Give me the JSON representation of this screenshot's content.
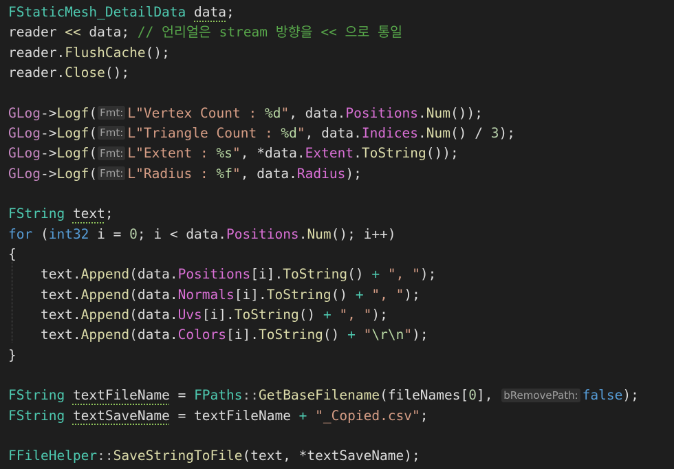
{
  "editor": {
    "lines": [
      [
        {
          "text": "FStaticMesh_DetailData",
          "type": "type"
        },
        {
          "text": " ",
          "type": "punc"
        },
        {
          "text": "data",
          "type": "var",
          "squiggle": true
        },
        {
          "text": ";",
          "type": "punc"
        }
      ],
      [
        {
          "text": "reader",
          "type": "var"
        },
        {
          "text": " ",
          "type": "punc"
        },
        {
          "text": "<<",
          "type": "func"
        },
        {
          "text": " data; ",
          "type": "var"
        },
        {
          "text": "// 언리얼은 stream 방향을 << 으로 통일",
          "type": "comment"
        }
      ],
      [
        {
          "text": "reader.",
          "type": "var"
        },
        {
          "text": "FlushCache",
          "type": "func"
        },
        {
          "text": "();",
          "type": "punc"
        }
      ],
      [
        {
          "text": "reader.",
          "type": "var"
        },
        {
          "text": "Close",
          "type": "func"
        },
        {
          "text": "();",
          "type": "punc"
        }
      ],
      [],
      [
        {
          "text": "GLog",
          "type": "macro"
        },
        {
          "text": "->",
          "type": "punc"
        },
        {
          "text": "Logf",
          "type": "func"
        },
        {
          "text": "(",
          "type": "punc"
        },
        {
          "text": "Fmt:",
          "type": "hint"
        },
        {
          "text": "L\"Vertex Count : ",
          "type": "str"
        },
        {
          "text": "%d",
          "type": "fmt"
        },
        {
          "text": "\"",
          "type": "str"
        },
        {
          "text": ", data.",
          "type": "var"
        },
        {
          "text": "Positions",
          "type": "field"
        },
        {
          "text": ".",
          "type": "punc"
        },
        {
          "text": "Num",
          "type": "func"
        },
        {
          "text": "());",
          "type": "punc"
        }
      ],
      [
        {
          "text": "GLog",
          "type": "macro"
        },
        {
          "text": "->",
          "type": "punc"
        },
        {
          "text": "Logf",
          "type": "func"
        },
        {
          "text": "(",
          "type": "punc"
        },
        {
          "text": "Fmt:",
          "type": "hint"
        },
        {
          "text": "L\"Triangle Count : ",
          "type": "str"
        },
        {
          "text": "%d",
          "type": "fmt"
        },
        {
          "text": "\"",
          "type": "str"
        },
        {
          "text": ", data.",
          "type": "var"
        },
        {
          "text": "Indices",
          "type": "field"
        },
        {
          "text": ".",
          "type": "punc"
        },
        {
          "text": "Num",
          "type": "func"
        },
        {
          "text": "() / ",
          "type": "punc"
        },
        {
          "text": "3",
          "type": "num"
        },
        {
          "text": ");",
          "type": "punc"
        }
      ],
      [
        {
          "text": "GLog",
          "type": "macro"
        },
        {
          "text": "->",
          "type": "punc"
        },
        {
          "text": "Logf",
          "type": "func"
        },
        {
          "text": "(",
          "type": "punc"
        },
        {
          "text": "Fmt:",
          "type": "hint"
        },
        {
          "text": "L\"Extent : ",
          "type": "str"
        },
        {
          "text": "%s",
          "type": "fmt"
        },
        {
          "text": "\"",
          "type": "str"
        },
        {
          "text": ", *data.",
          "type": "var"
        },
        {
          "text": "Extent",
          "type": "field"
        },
        {
          "text": ".",
          "type": "punc"
        },
        {
          "text": "ToString",
          "type": "func"
        },
        {
          "text": "());",
          "type": "punc"
        }
      ],
      [
        {
          "text": "GLog",
          "type": "macro"
        },
        {
          "text": "->",
          "type": "punc"
        },
        {
          "text": "Logf",
          "type": "func"
        },
        {
          "text": "(",
          "type": "punc"
        },
        {
          "text": "Fmt:",
          "type": "hint"
        },
        {
          "text": "L\"Radius : ",
          "type": "str"
        },
        {
          "text": "%f",
          "type": "fmt"
        },
        {
          "text": "\"",
          "type": "str"
        },
        {
          "text": ", data.",
          "type": "var"
        },
        {
          "text": "Radius",
          "type": "field"
        },
        {
          "text": ");",
          "type": "punc"
        }
      ],
      [],
      [
        {
          "text": "FString",
          "type": "type"
        },
        {
          "text": " ",
          "type": "punc"
        },
        {
          "text": "text",
          "type": "var",
          "squiggle": true
        },
        {
          "text": ";",
          "type": "punc"
        }
      ],
      [
        {
          "text": "for",
          "type": "kw"
        },
        {
          "text": " (",
          "type": "punc"
        },
        {
          "text": "int32",
          "type": "kw"
        },
        {
          "text": " i = ",
          "type": "var"
        },
        {
          "text": "0",
          "type": "num"
        },
        {
          "text": "; i < data.",
          "type": "var"
        },
        {
          "text": "Positions",
          "type": "field"
        },
        {
          "text": ".",
          "type": "punc"
        },
        {
          "text": "Num",
          "type": "func"
        },
        {
          "text": "(); i++)",
          "type": "punc"
        }
      ],
      [
        {
          "text": "{",
          "type": "punc"
        }
      ],
      [
        {
          "text": "    text.",
          "type": "var"
        },
        {
          "text": "Append",
          "type": "func"
        },
        {
          "text": "(data.",
          "type": "var"
        },
        {
          "text": "Positions",
          "type": "field"
        },
        {
          "text": "[i].",
          "type": "punc"
        },
        {
          "text": "ToString",
          "type": "func"
        },
        {
          "text": "() ",
          "type": "punc"
        },
        {
          "text": "+",
          "type": "type"
        },
        {
          "text": " ",
          "type": "punc"
        },
        {
          "text": "\", \"",
          "type": "str"
        },
        {
          "text": ");",
          "type": "punc"
        }
      ],
      [
        {
          "text": "    text.",
          "type": "var"
        },
        {
          "text": "Append",
          "type": "func"
        },
        {
          "text": "(data.",
          "type": "var"
        },
        {
          "text": "Normals",
          "type": "field"
        },
        {
          "text": "[i].",
          "type": "punc"
        },
        {
          "text": "ToString",
          "type": "func"
        },
        {
          "text": "() ",
          "type": "punc"
        },
        {
          "text": "+",
          "type": "type"
        },
        {
          "text": " ",
          "type": "punc"
        },
        {
          "text": "\", \"",
          "type": "str"
        },
        {
          "text": ");",
          "type": "punc"
        }
      ],
      [
        {
          "text": "    text.",
          "type": "var"
        },
        {
          "text": "Append",
          "type": "func"
        },
        {
          "text": "(data.",
          "type": "var"
        },
        {
          "text": "Uvs",
          "type": "field"
        },
        {
          "text": "[i].",
          "type": "punc"
        },
        {
          "text": "ToString",
          "type": "func"
        },
        {
          "text": "() ",
          "type": "punc"
        },
        {
          "text": "+",
          "type": "type"
        },
        {
          "text": " ",
          "type": "punc"
        },
        {
          "text": "\", \"",
          "type": "str"
        },
        {
          "text": ");",
          "type": "punc"
        }
      ],
      [
        {
          "text": "    text.",
          "type": "var"
        },
        {
          "text": "Append",
          "type": "func"
        },
        {
          "text": "(data.",
          "type": "var"
        },
        {
          "text": "Colors",
          "type": "field"
        },
        {
          "text": "[i].",
          "type": "punc"
        },
        {
          "text": "ToString",
          "type": "func"
        },
        {
          "text": "() ",
          "type": "punc"
        },
        {
          "text": "+",
          "type": "type"
        },
        {
          "text": " ",
          "type": "punc"
        },
        {
          "text": "\"",
          "type": "str"
        },
        {
          "text": "\\r\\n",
          "type": "fmt"
        },
        {
          "text": "\"",
          "type": "str"
        },
        {
          "text": ");",
          "type": "punc"
        }
      ],
      [
        {
          "text": "}",
          "type": "punc"
        }
      ],
      [],
      [
        {
          "text": "FString",
          "type": "type"
        },
        {
          "text": " ",
          "type": "punc"
        },
        {
          "text": "textFileName",
          "type": "var",
          "squiggle": true
        },
        {
          "text": " = ",
          "type": "punc"
        },
        {
          "text": "FPaths",
          "type": "type"
        },
        {
          "text": "::",
          "type": "op"
        },
        {
          "text": "GetBaseFilename",
          "type": "func"
        },
        {
          "text": "(fileNames[",
          "type": "var"
        },
        {
          "text": "0",
          "type": "num"
        },
        {
          "text": "], ",
          "type": "punc"
        },
        {
          "text": "bRemovePath:",
          "type": "hint"
        },
        {
          "text": "false",
          "type": "kw"
        },
        {
          "text": ");",
          "type": "punc"
        }
      ],
      [
        {
          "text": "FString",
          "type": "type"
        },
        {
          "text": " ",
          "type": "punc"
        },
        {
          "text": "textSaveName",
          "type": "var",
          "squiggle": true
        },
        {
          "text": " = textFileName ",
          "type": "var"
        },
        {
          "text": "+",
          "type": "type"
        },
        {
          "text": " ",
          "type": "punc"
        },
        {
          "text": "\"_Copied.csv\"",
          "type": "str"
        },
        {
          "text": ";",
          "type": "punc"
        }
      ],
      [],
      [
        {
          "text": "FFileHelper",
          "type": "type"
        },
        {
          "text": "::",
          "type": "op"
        },
        {
          "text": "SaveStringToFile",
          "type": "func"
        },
        {
          "text": "(text, *textSaveName);",
          "type": "var"
        }
      ]
    ]
  }
}
